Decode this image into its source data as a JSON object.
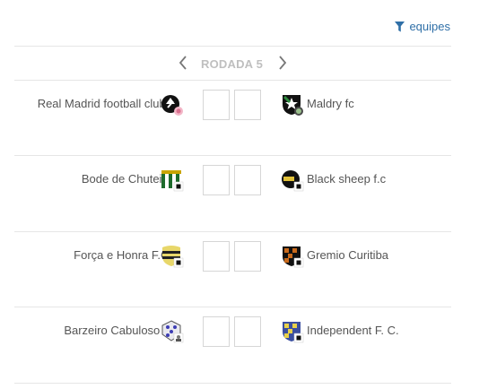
{
  "filter": {
    "icon": "funnel-icon",
    "label": "equipes"
  },
  "round": {
    "label": "RODADA 5",
    "prev_icon": "chevron-left-icon",
    "next_icon": "chevron-right-icon"
  },
  "matches": [
    {
      "home": "Real Madrid football clube",
      "home_badge": "team-shield-icon",
      "home_score": "",
      "away_score": "",
      "away": "Maldry fc",
      "away_badge": "team-shield-icon"
    },
    {
      "home": "Bode de Chuteira",
      "home_badge": "team-shield-icon",
      "home_score": "",
      "away_score": "",
      "away": "Black sheep f.c",
      "away_badge": "team-shield-icon"
    },
    {
      "home": "Força e Honra F.C.",
      "home_badge": "team-shield-icon",
      "home_score": "",
      "away_score": "",
      "away": "Gremio Curitiba",
      "away_badge": "team-shield-icon"
    },
    {
      "home": "Barzeiro Cabuloso fc",
      "home_badge": "team-shield-icon",
      "home_score": "",
      "away_score": "",
      "away": "Independent F. C.",
      "away_badge": "team-shield-icon"
    }
  ],
  "colors": {
    "link": "#2f6fa7",
    "muted": "#bfbfbf",
    "text": "#555555",
    "divider": "#e6e6e6"
  }
}
